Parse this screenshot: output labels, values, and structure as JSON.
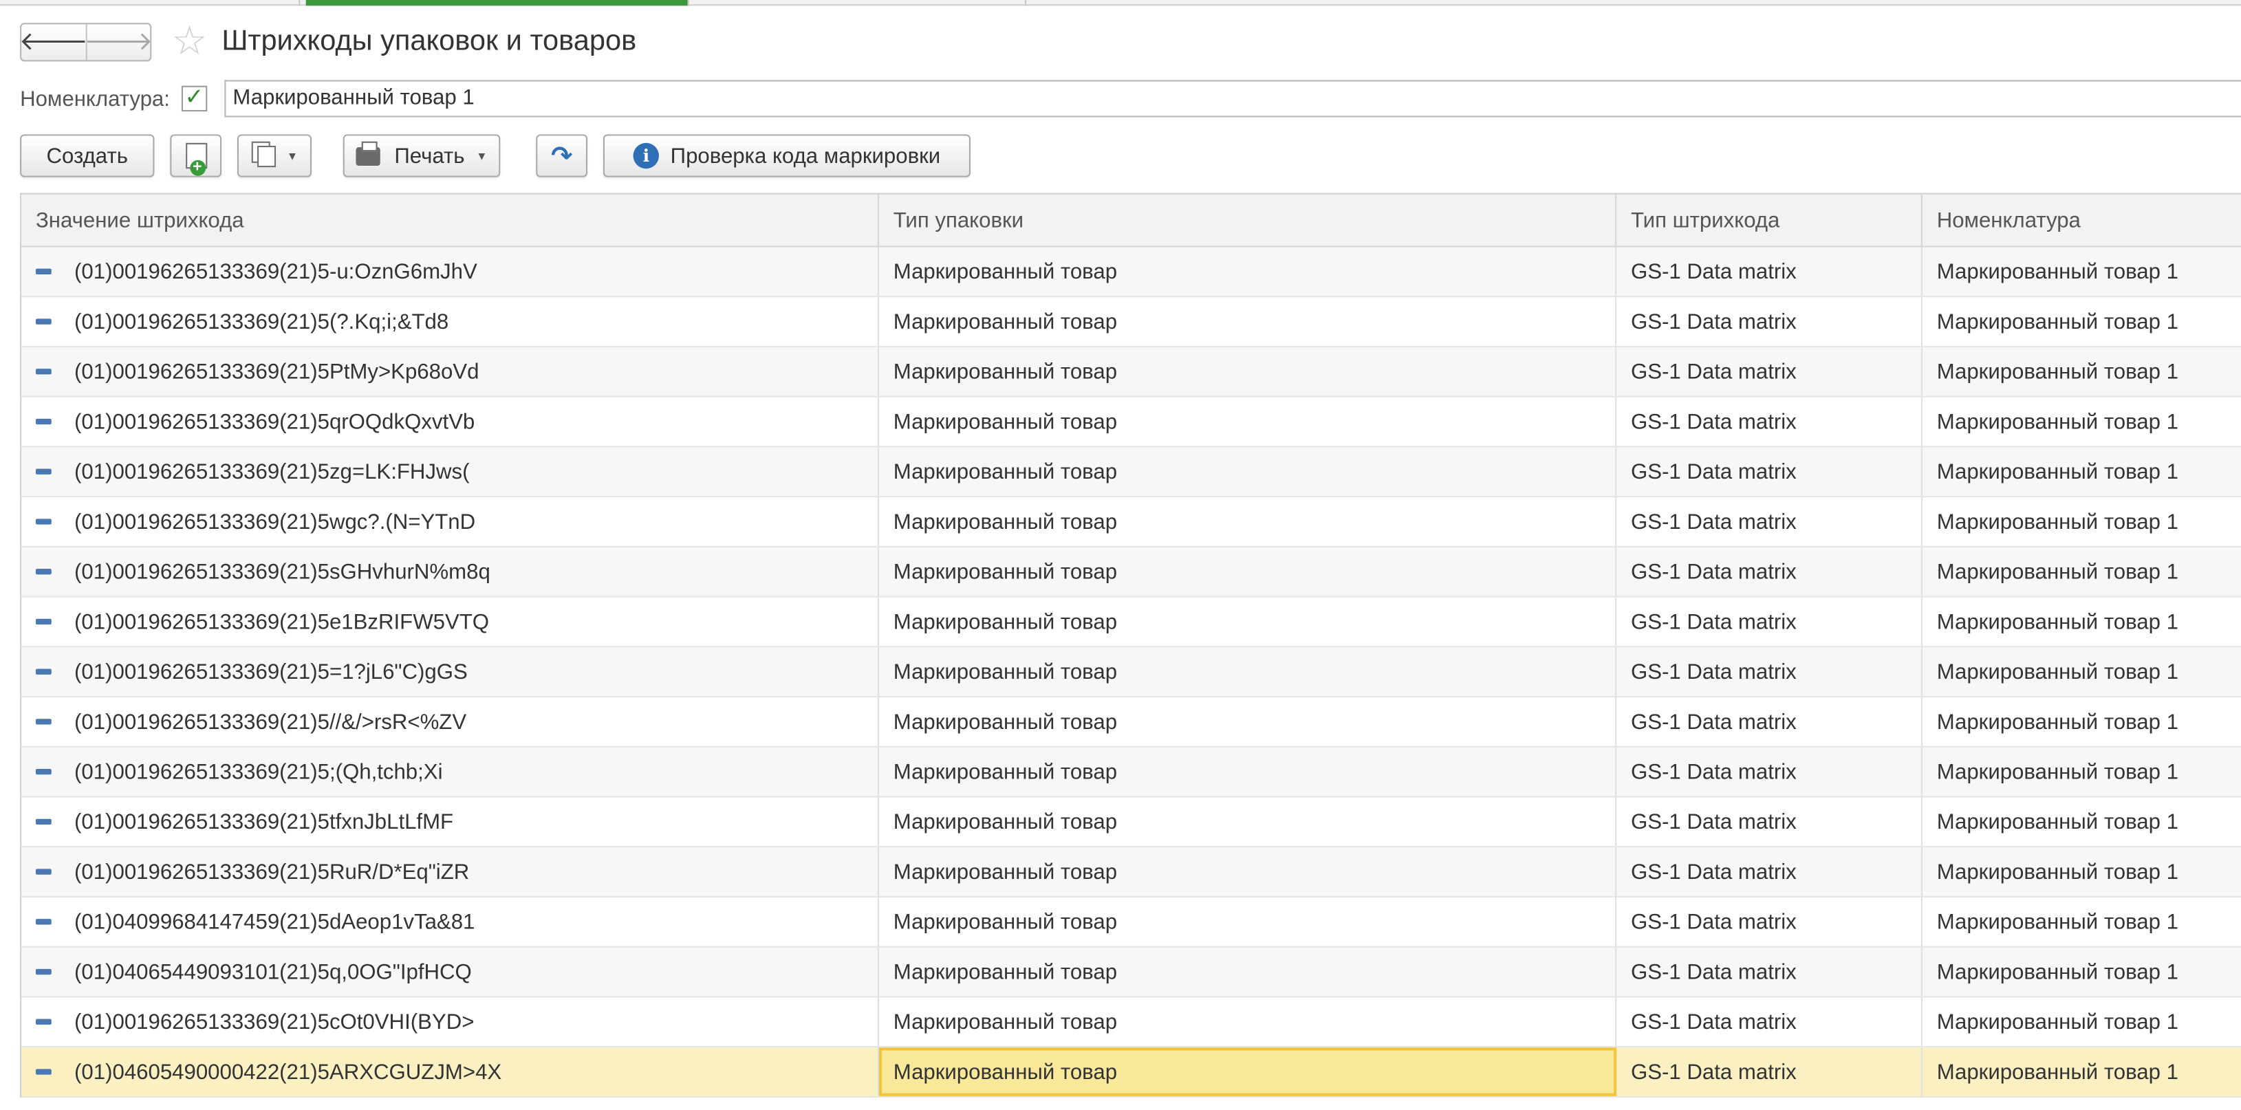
{
  "header": {
    "title": "Штрихкоды упаковок и товаров",
    "back_glyph": "🡐",
    "forward_glyph": "🡒"
  },
  "filter": {
    "label": "Номенклатура:",
    "checked": true,
    "value": "Маркированный товар 1"
  },
  "toolbar": {
    "create_label": "Создать",
    "print_label": "Печать",
    "check_code_label": "Проверка кода маркировки"
  },
  "table": {
    "columns": [
      "Значение штрихкода",
      "Тип упаковки",
      "Тип штрихкода",
      "Номенклатура"
    ],
    "rows": [
      {
        "barcode": "(01)00196265133369(21)5-u:OznG6mJhV",
        "pack": "Маркированный товар",
        "type": "GS-1 Data matrix",
        "item": "Маркированный товар 1"
      },
      {
        "barcode": "(01)00196265133369(21)5(?.Kq;i;&Td8",
        "pack": "Маркированный товар",
        "type": "GS-1 Data matrix",
        "item": "Маркированный товар 1"
      },
      {
        "barcode": "(01)00196265133369(21)5PtMy>Kp68oVd",
        "pack": "Маркированный товар",
        "type": "GS-1 Data matrix",
        "item": "Маркированный товар 1"
      },
      {
        "barcode": "(01)00196265133369(21)5qrOQdkQxvtVb",
        "pack": "Маркированный товар",
        "type": "GS-1 Data matrix",
        "item": "Маркированный товар 1"
      },
      {
        "barcode": "(01)00196265133369(21)5zg=LK:FHJws(",
        "pack": "Маркированный товар",
        "type": "GS-1 Data matrix",
        "item": "Маркированный товар 1"
      },
      {
        "barcode": "(01)00196265133369(21)5wgc?.(N=YTnD",
        "pack": "Маркированный товар",
        "type": "GS-1 Data matrix",
        "item": "Маркированный товар 1"
      },
      {
        "barcode": "(01)00196265133369(21)5sGHvhurN%m8q",
        "pack": "Маркированный товар",
        "type": "GS-1 Data matrix",
        "item": "Маркированный товар 1"
      },
      {
        "barcode": "(01)00196265133369(21)5e1BzRIFW5VTQ",
        "pack": "Маркированный товар",
        "type": "GS-1 Data matrix",
        "item": "Маркированный товар 1"
      },
      {
        "barcode": "(01)00196265133369(21)5=1?jL6\"C)gGS",
        "pack": "Маркированный товар",
        "type": "GS-1 Data matrix",
        "item": "Маркированный товар 1"
      },
      {
        "barcode": "(01)00196265133369(21)5//&/>rsR<%ZV",
        "pack": "Маркированный товар",
        "type": "GS-1 Data matrix",
        "item": "Маркированный товар 1"
      },
      {
        "barcode": "(01)00196265133369(21)5;(Qh,tchb;Xi",
        "pack": "Маркированный товар",
        "type": "GS-1 Data matrix",
        "item": "Маркированный товар 1"
      },
      {
        "barcode": "(01)00196265133369(21)5tfxnJbLtLfMF",
        "pack": "Маркированный товар",
        "type": "GS-1 Data matrix",
        "item": "Маркированный товар 1"
      },
      {
        "barcode": "(01)00196265133369(21)5RuR/D*Eq\"iZR",
        "pack": "Маркированный товар",
        "type": "GS-1 Data matrix",
        "item": "Маркированный товар 1"
      },
      {
        "barcode": "(01)04099684147459(21)5dAeop1vTa&81",
        "pack": "Маркированный товар",
        "type": "GS-1 Data matrix",
        "item": "Маркированный товар 1"
      },
      {
        "barcode": "(01)04065449093101(21)5q,0OG\"IpfHCQ",
        "pack": "Маркированный товар",
        "type": "GS-1 Data matrix",
        "item": "Маркированный товар 1"
      },
      {
        "barcode": "(01)00196265133369(21)5cOt0VHI(BYD>",
        "pack": "Маркированный товар",
        "type": "GS-1 Data matrix",
        "item": "Маркированный товар 1"
      },
      {
        "barcode": "(01)04605490000422(21)5ARXCGUZJM>4X",
        "pack": "Маркированный товар",
        "type": "GS-1 Data matrix",
        "item": "Маркированный товар 1",
        "selected": true
      }
    ]
  },
  "colors": {
    "accent": "#3c9a3c",
    "selection": "#fbf0c2",
    "selected_cell": "#f9e79a",
    "row_icon": "#4a78b0"
  }
}
